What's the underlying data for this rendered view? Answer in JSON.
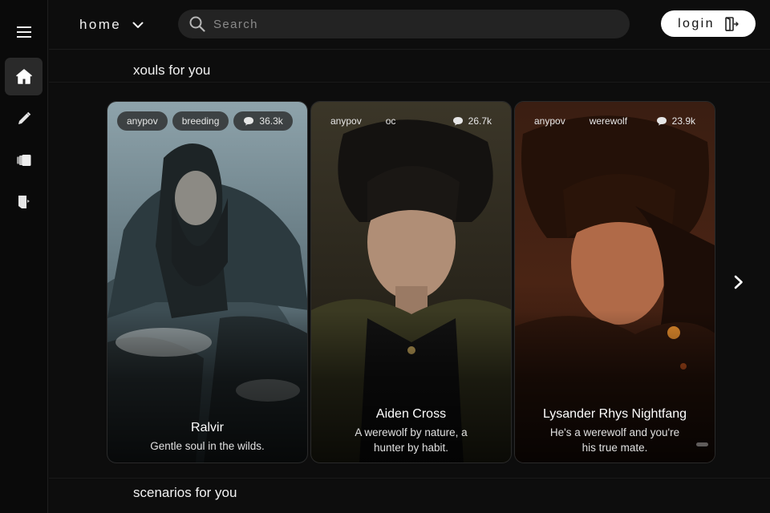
{
  "header": {
    "home_label": "home",
    "search_placeholder": "Search",
    "login_label": "login"
  },
  "sidebar": {
    "items": [
      {
        "icon": "menu-icon"
      },
      {
        "icon": "home-icon",
        "active": true
      },
      {
        "icon": "pencil-icon"
      },
      {
        "icon": "cards-icon"
      },
      {
        "icon": "book-icon"
      }
    ]
  },
  "sections": {
    "xouls_title": "xouls for you",
    "scenarios_title": "scenarios for you"
  },
  "cards": [
    {
      "tags": [
        "anypov",
        "breeding"
      ],
      "count": "36.3k",
      "name": "Ralvir",
      "description": "Gentle soul in the wilds."
    },
    {
      "tags": [
        "anypov",
        "oc"
      ],
      "count": "26.7k",
      "name": "Aiden Cross",
      "description": "A werewolf by nature, a hunter by habit."
    },
    {
      "tags": [
        "anypov",
        "werewolf"
      ],
      "count": "23.9k",
      "name": "Lysander Rhys Nightfang",
      "description": "He's a werewolf and you're his true mate."
    }
  ],
  "colors": {
    "background": "#0d0d0d",
    "sidebar_active": "#2a2a2a",
    "search_bg": "#232323",
    "login_bg": "#ffffff"
  }
}
